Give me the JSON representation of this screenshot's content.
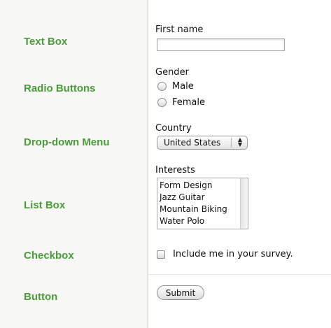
{
  "categories": {
    "text_box": "Text Box",
    "radio_buttons": "Radio Buttons",
    "dropdown_menu": "Drop-down Menu",
    "list_box": "List Box",
    "checkbox": "Checkbox",
    "button": "Button"
  },
  "form": {
    "first_name": {
      "label": "First name",
      "value": ""
    },
    "gender": {
      "label": "Gender",
      "options": [
        "Male",
        "Female"
      ]
    },
    "country": {
      "label": "Country",
      "selected": "United States"
    },
    "interests": {
      "label": "Interests",
      "items": [
        "Form Design",
        "Jazz Guitar",
        "Mountain Biking",
        "Water Polo"
      ]
    },
    "survey": {
      "label": "Include me in your survey.",
      "checked": false
    },
    "submit": {
      "label": "Submit"
    }
  },
  "colors": {
    "category_label": "#4a9b3a",
    "left_panel": "#f7f7f5"
  }
}
